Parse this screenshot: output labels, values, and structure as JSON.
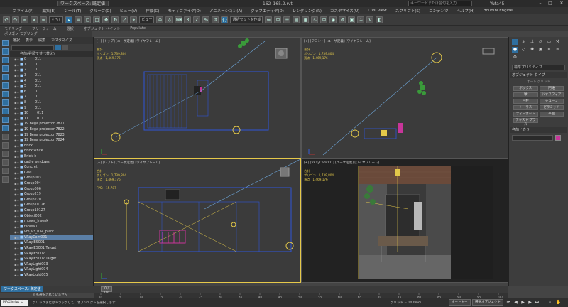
{
  "titlebar": {
    "workspace": "ワークスペース: 既定値",
    "title": "162_165.2.rvt",
    "search_placeholder": "キーワードまたは語句を入力",
    "user": "Yuta45"
  },
  "menu": [
    "ファイル(F)",
    "編集(E)",
    "ツール(T)",
    "グループ(G)",
    "ビュー(V)",
    "作成(C)",
    "モディファイヤ(O)",
    "アニメーション(A)",
    "グラフエディタ(D)",
    "レンダリング(R)",
    "カスタマイズ(U)",
    "Civil View",
    "スクリプト(S)",
    "コンテンツ",
    "ヘルプ(H)",
    "Houdini Engine"
  ],
  "toolbar": {
    "filter_label": "すべて",
    "view_label": "ビュー",
    "selset_label": "選択セットを作成"
  },
  "ribbon": {
    "row1": [
      "モデリング",
      "フリーフォーム",
      "選択",
      "オブジェクト ペイント",
      "Populate"
    ],
    "row2": "ポリゴン モデリング"
  },
  "explorer": {
    "tabs": [
      "選択",
      "表示",
      "編集",
      "カスタマイズ"
    ],
    "header": "名前(昇順で並べ替え)",
    "items": [
      "0",
      "1",
      "2",
      "3",
      "4",
      "5",
      "6",
      "7",
      "8",
      "9",
      "10",
      "11",
      "19 Bega projector 7821",
      "19 Bega projector 7822",
      "19 Bega projector 7823",
      "19 Bega projector 7824",
      "Brick",
      "Brick white",
      "Brick_h",
      "cadre windows",
      "Concret",
      "Glas",
      "Group003",
      "Group004",
      "Group006",
      "Group219",
      "Group220",
      "Group10126",
      "Group10127",
      "Object002",
      "rhuger_Insenk",
      "tableau",
      "vm_v3_034_plant",
      "VRayCam001",
      "VRayIES001",
      "VRayIES001.Target",
      "VRayIES002",
      "VRayIES002.Target",
      "VRayLight003",
      "VRayLight004",
      "VRayLight005",
      "VRayLight005.Target",
      "VRayLight006",
      "VRayLight006.Target"
    ],
    "item_suffix": [
      "011",
      "011",
      "011",
      "011",
      "011",
      "011",
      "011",
      "011",
      "011",
      "011",
      "011",
      "011"
    ]
  },
  "viewports": {
    "top": {
      "label": "[+] [トップ] [ユーザ定義] [ワイヤフレーム]"
    },
    "front": {
      "label": "[+] [フロント] [ユーザ定義] [ワイヤフレーム]"
    },
    "left": {
      "label": "[+] [レフト] [ユーザ定義] [ワイヤフレーム]",
      "fps": "FPS:   15.787"
    },
    "camera": {
      "label": "[+] [VRayCam001] [ユーザ定義] [ワイヤフレーム]"
    },
    "stats": {
      "total": "合計",
      "poly_label": "ポリゴン",
      "poly_value": "1,739,804",
      "vert_label": "頂点",
      "vert_value": "1,469,176"
    }
  },
  "cmdpanel": {
    "dropdown": "標準プリミティブ",
    "section1": "オブジェクト タイプ",
    "autogrid": "オート グリッド",
    "buttons": [
      "ボックス",
      "円錐",
      "球",
      "ジオスフィア",
      "円柱",
      "チューブ",
      "トーラス",
      "ピラミッド",
      "ティーポット",
      "平面",
      "テキスト プラス",
      ""
    ],
    "section2": "名前とカラー",
    "name_color": "#c8359a"
  },
  "bottom": {
    "layer": "ワークスペース: 既定値",
    "frame": "0 / 100",
    "ruler_ticks": [
      "0",
      "5",
      "10",
      "15",
      "20",
      "25",
      "30",
      "35",
      "40",
      "45",
      "50",
      "55",
      "60",
      "65",
      "70",
      "75",
      "80",
      "85",
      "90",
      "95",
      "100"
    ],
    "maxscript": "MAXScript に",
    "msg_top": "何も選択されていません",
    "msg_bottom": "クリックまたはドラッグして、オブジェクトを選択します",
    "grid": "グリッド = 10.0mm",
    "addtime": "時間タグを追加",
    "auto_key": "オートキー",
    "set_key": "キーを設定",
    "selected": "選択オブジェクト",
    "key_filter": "キー フィルタ..."
  },
  "colors": {
    "accent": "#2f6f9f",
    "active_border": "#e5c84a",
    "wire_blue": "#2f56d8",
    "wire_yellow": "#e3c84a",
    "plant_green": "#3a9a3a",
    "magenta": "#c8359a"
  }
}
